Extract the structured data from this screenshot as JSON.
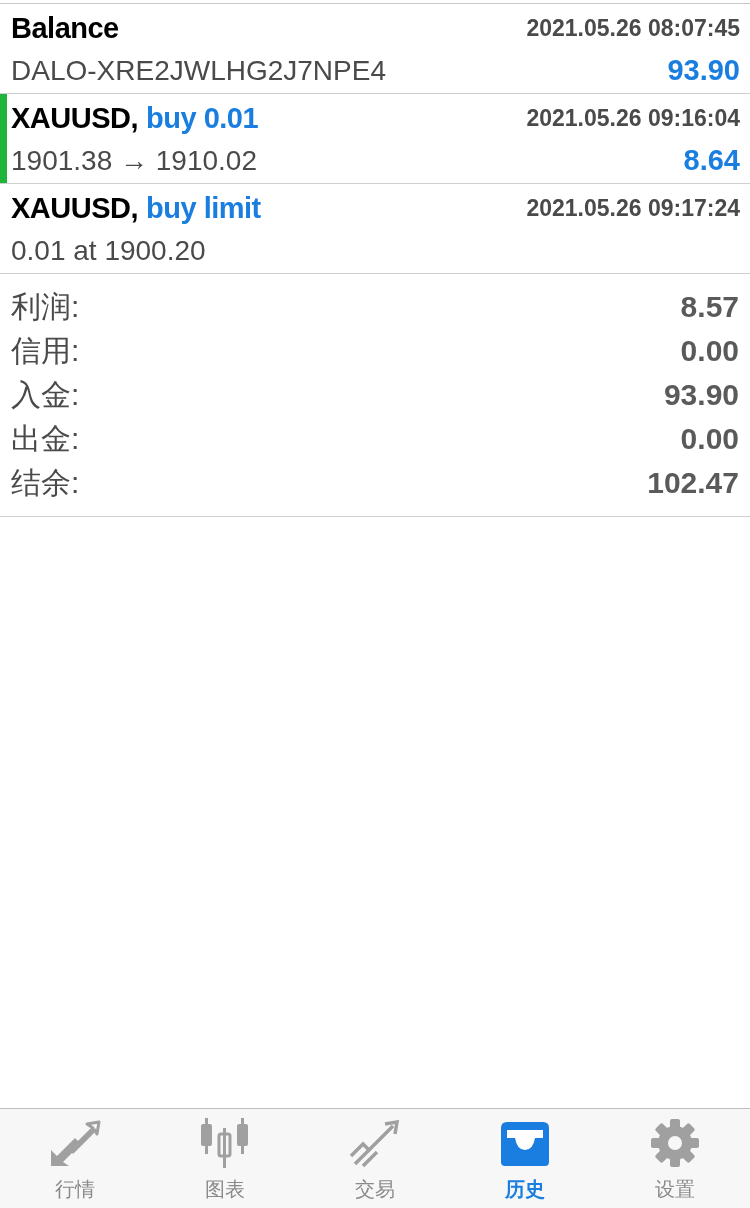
{
  "history": [
    {
      "title": "Balance",
      "time": "2021.05.26 08:07:45",
      "detail": "DALO-XRE2JWLHG2J7NPE4",
      "amount": "93.90"
    },
    {
      "title": "XAUUSD,",
      "action": "buy 0.01",
      "time": "2021.05.26 09:16:04",
      "detail": "1901.38 → 1910.02",
      "amount": "8.64",
      "color": "#1fb53b"
    },
    {
      "title": "XAUUSD,",
      "action": "buy limit",
      "time": "2021.05.26 09:17:24",
      "detail": "0.01 at 1900.20"
    }
  ],
  "summary": [
    {
      "label": "利润:",
      "value": "8.57"
    },
    {
      "label": "信用:",
      "value": "0.00"
    },
    {
      "label": "入金:",
      "value": "93.90"
    },
    {
      "label": "出金:",
      "value": "0.00"
    },
    {
      "label": "结余:",
      "value": "102.47"
    }
  ],
  "tabs": [
    {
      "kind": "quotes",
      "label": "行情",
      "selected": false
    },
    {
      "kind": "chart",
      "label": "图表",
      "selected": false
    },
    {
      "kind": "trade",
      "label": "交易",
      "selected": false
    },
    {
      "kind": "history",
      "label": "历史",
      "selected": true
    },
    {
      "kind": "settings",
      "label": "设置",
      "selected": false
    }
  ]
}
